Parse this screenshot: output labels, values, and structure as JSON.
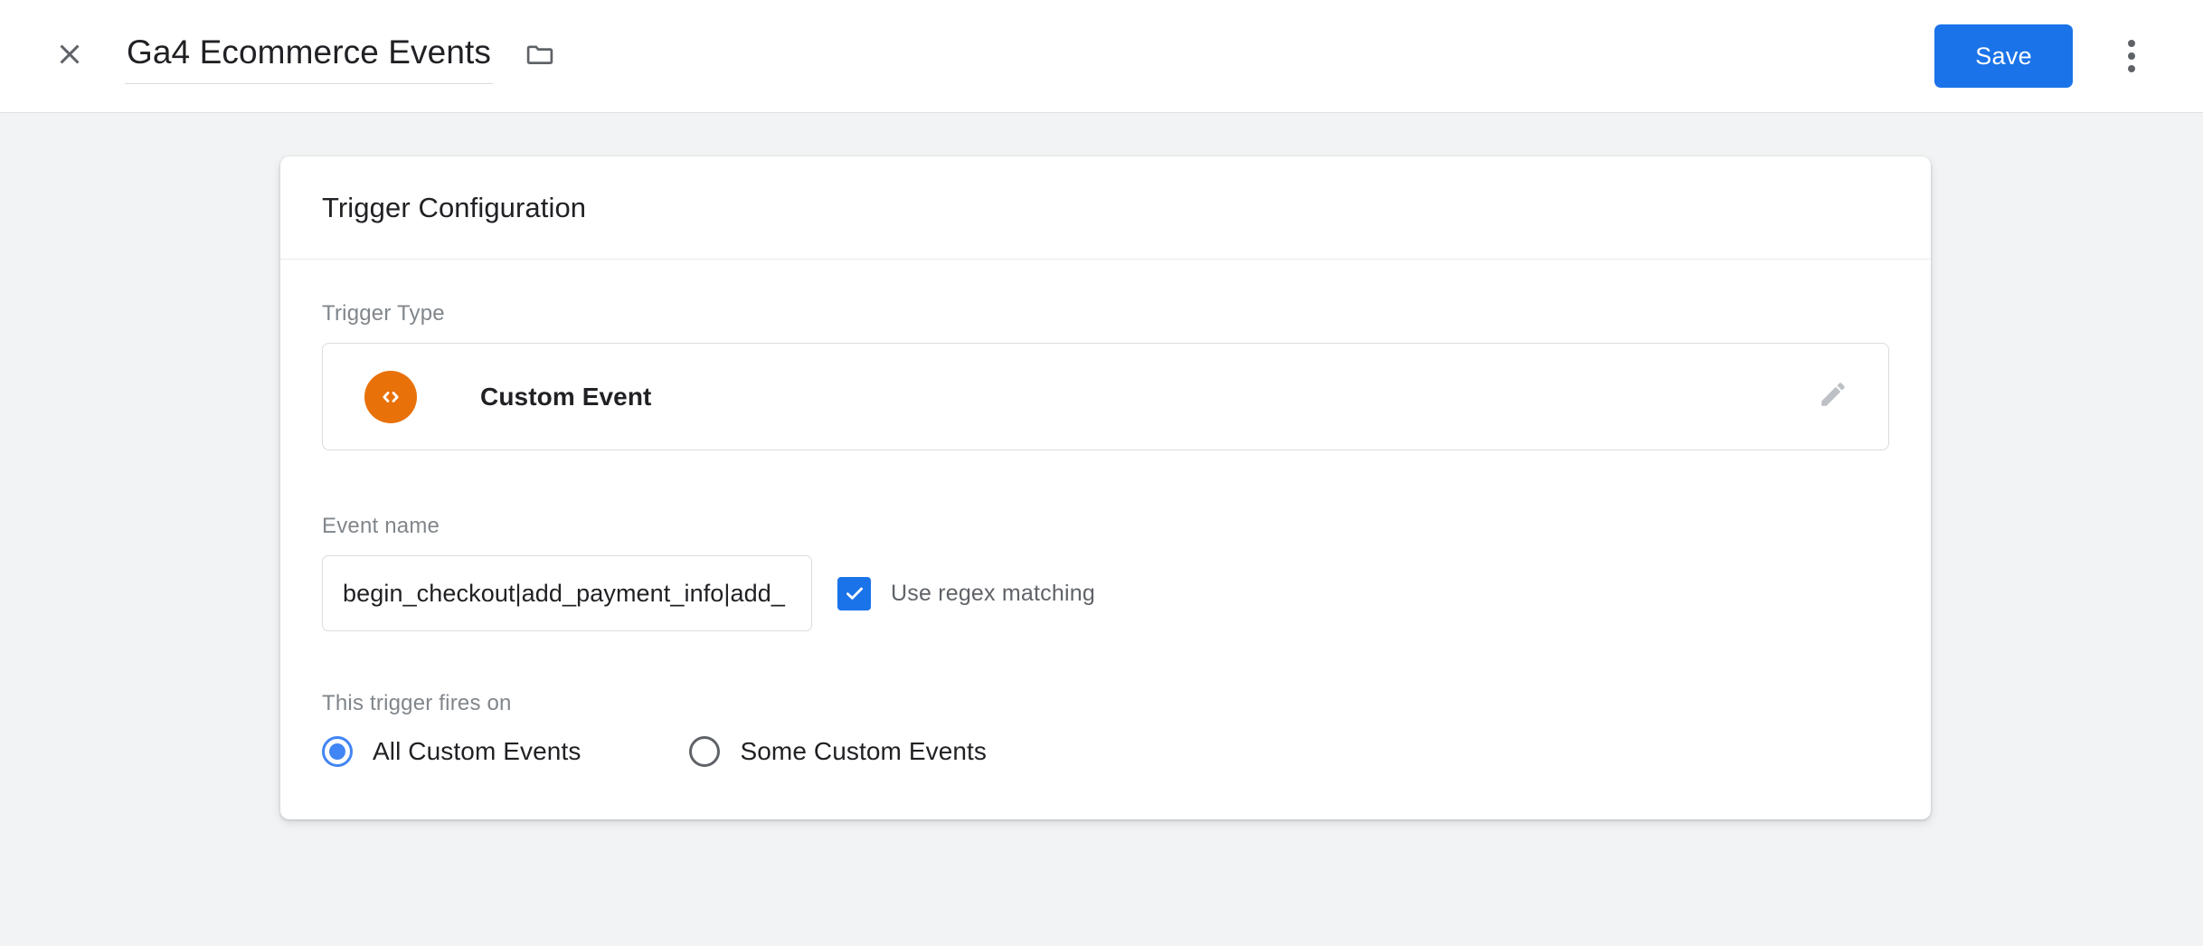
{
  "header": {
    "close_icon": "close-icon",
    "title": "Ga4 Ecommerce Events",
    "folder_icon": "folder-icon",
    "save_label": "Save",
    "overflow_icon": "more-vert-icon",
    "accent_color": "#1a73e8"
  },
  "card": {
    "title": "Trigger Configuration",
    "trigger_type": {
      "label": "Trigger Type",
      "icon": "code-brackets-icon",
      "icon_color": "#e8710a",
      "name": "Custom Event",
      "edit_icon": "pencil-icon"
    },
    "event_name": {
      "label": "Event name",
      "value": "begin_checkout|add_payment_info|add_",
      "placeholder": "",
      "regex_label": "Use regex matching",
      "regex_checked": true,
      "checkbox_color": "#1a73e8"
    },
    "fires_on": {
      "label": "This trigger fires on",
      "selected": "All Custom Events",
      "options": [
        {
          "label": "All Custom Events",
          "checked": true
        },
        {
          "label": "Some Custom Events",
          "checked": false
        }
      ],
      "radio_color": "#4285f4"
    }
  }
}
